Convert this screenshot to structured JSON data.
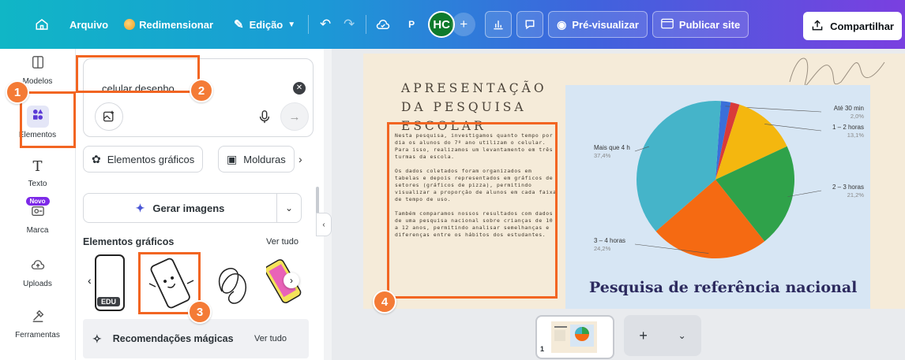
{
  "topbar": {
    "home_icon": "home-icon",
    "file_label": "Arquivo",
    "resize_label": "Redimensionar",
    "edit_label": "Edição",
    "avatar_p": "P",
    "avatar_hc": "HC",
    "preview_label": "Pré-visualizar",
    "publish_label": "Publicar site",
    "share_label": "Compartilhar"
  },
  "rail": {
    "items": [
      {
        "label": "Modelos",
        "icon": "templates-icon"
      },
      {
        "label": "Elementos",
        "icon": "elements-icon"
      },
      {
        "label": "Texto",
        "icon": "text-icon"
      },
      {
        "label": "Marca",
        "icon": "brand-icon",
        "badge": "Novo"
      },
      {
        "label": "Uploads",
        "icon": "upload-icon"
      },
      {
        "label": "Ferramentas",
        "icon": "tools-icon"
      }
    ]
  },
  "panel": {
    "search_value": "celular desenho",
    "chips": [
      "Elementos gráficos",
      "Molduras"
    ],
    "generate_label": "Gerar imagens",
    "section_title": "Elementos gráficos",
    "see_all": "Ver tudo",
    "edu_badge": "EDU",
    "magic_label": "Recomendações mágicas",
    "magic_see_all": "Ver tudo"
  },
  "slide": {
    "title": "APRESENTAÇÃO DA PESQUISA ESCOLAR",
    "paragraphs": [
      "Nesta pesquisa, investigamos quanto tempo por dia os alunos do 7º ano utilizam o celular. Para isso, realizamos um levantamento em três turmas da escola.",
      "Os dados coletados foram organizados em tabelas e depois representados em gráficos de setores (gráficos de pizza), permitindo visualizar a proporção de alunos em cada faixa de tempo de uso.",
      "Também comparamos nossos resultados com dados de uma pesquisa nacional sobre crianças de 10 a 12 anos, permitindo analisar semelhanças e diferenças entre os hábitos dos estudantes."
    ],
    "card_title": "Pesquisa de referência nacional"
  },
  "chart_data": {
    "type": "pie",
    "slices": [
      {
        "label": "Até 30 min",
        "value": 2.0,
        "pct_label": "2,0%",
        "color": "#3b6fd9"
      },
      {
        "label": "",
        "value": 1.8,
        "pct_label": "",
        "color": "#d93a3a"
      },
      {
        "label": "1 – 2 horas",
        "value": 13.1,
        "pct_label": "13,1%",
        "color": "#f4b70f"
      },
      {
        "label": "2 – 3 horas",
        "value": 21.2,
        "pct_label": "21,2%",
        "color": "#2fa24a"
      },
      {
        "label": "3 – 4 horas",
        "value": 24.2,
        "pct_label": "24,2%",
        "color": "#f56a12"
      },
      {
        "label": "Mais que 4 h",
        "value": 37.4,
        "pct_label": "37,4%",
        "color": "#45b4c9"
      }
    ]
  },
  "pages": {
    "current_page": "1"
  },
  "annotations": [
    "1",
    "2",
    "3",
    "4"
  ],
  "colors": {
    "accent": "#f26522",
    "hc_avatar": "#0f7a2c",
    "novo_badge": "#7d2ae8"
  }
}
